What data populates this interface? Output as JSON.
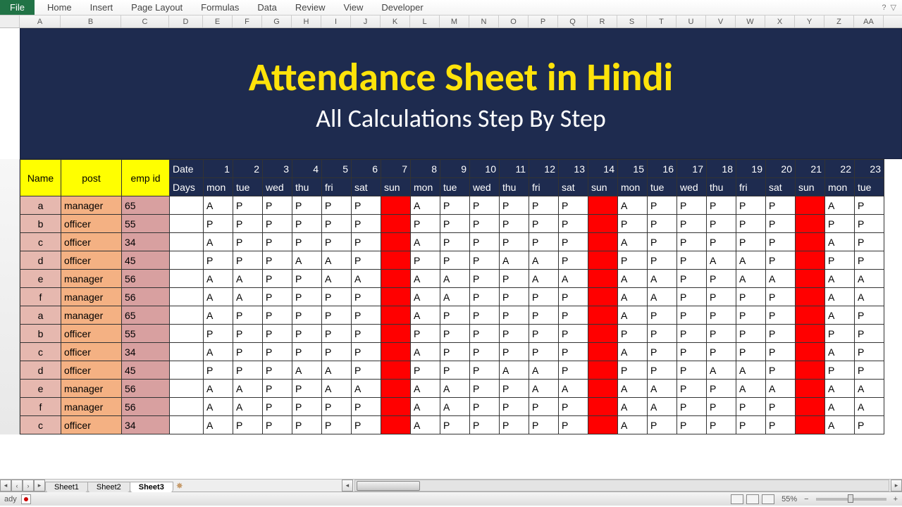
{
  "ribbon": {
    "file": "File",
    "tabs": [
      "Home",
      "Insert",
      "Page Layout",
      "Formulas",
      "Data",
      "Review",
      "View",
      "Developer"
    ]
  },
  "columns_excel": [
    "A",
    "B",
    "C",
    "D",
    "E",
    "F",
    "G",
    "H",
    "I",
    "J",
    "K",
    "L",
    "M",
    "N",
    "O",
    "P",
    "Q",
    "R",
    "S",
    "T",
    "U",
    "V",
    "W",
    "X",
    "Y",
    "Z",
    "AA"
  ],
  "banner": {
    "title": "Attendance Sheet in Hindi",
    "subtitle": "All Calculations Step By Step"
  },
  "headers": {
    "name": "Name",
    "post": "post",
    "empid": "emp id",
    "date_label": "Date",
    "days_label": "Days",
    "dates": [
      1,
      2,
      3,
      4,
      5,
      6,
      7,
      8,
      9,
      10,
      11,
      12,
      13,
      14,
      15,
      16,
      17,
      18,
      19,
      20,
      21,
      22,
      23
    ],
    "days": [
      "mon",
      "tue",
      "wed",
      "thu",
      "fri",
      "sat",
      "sun",
      "mon",
      "tue",
      "wed",
      "thu",
      "fri",
      "sat",
      "sun",
      "mon",
      "tue",
      "wed",
      "thu",
      "fri",
      "sat",
      "sun",
      "mon",
      "tue"
    ]
  },
  "rows": [
    {
      "name": "a",
      "post": "manager",
      "emp": "65",
      "att": [
        "A",
        "P",
        "P",
        "P",
        "P",
        "P",
        "",
        "A",
        "P",
        "P",
        "P",
        "P",
        "P",
        "",
        "A",
        "P",
        "P",
        "P",
        "P",
        "P",
        "",
        "A",
        "P"
      ]
    },
    {
      "name": "b",
      "post": "officer",
      "emp": "55",
      "att": [
        "P",
        "P",
        "P",
        "P",
        "P",
        "P",
        "",
        "P",
        "P",
        "P",
        "P",
        "P",
        "P",
        "",
        "P",
        "P",
        "P",
        "P",
        "P",
        "P",
        "",
        "P",
        "P"
      ]
    },
    {
      "name": "c",
      "post": "officer",
      "emp": "34",
      "att": [
        "A",
        "P",
        "P",
        "P",
        "P",
        "P",
        "",
        "A",
        "P",
        "P",
        "P",
        "P",
        "P",
        "",
        "A",
        "P",
        "P",
        "P",
        "P",
        "P",
        "",
        "A",
        "P"
      ]
    },
    {
      "name": "d",
      "post": "officer",
      "emp": "45",
      "att": [
        "P",
        "P",
        "P",
        "A",
        "A",
        "P",
        "",
        "P",
        "P",
        "P",
        "A",
        "A",
        "P",
        "",
        "P",
        "P",
        "P",
        "A",
        "A",
        "P",
        "",
        "P",
        "P"
      ]
    },
    {
      "name": "e",
      "post": "manager",
      "emp": "56",
      "att": [
        "A",
        "A",
        "P",
        "P",
        "A",
        "A",
        "",
        "A",
        "A",
        "P",
        "P",
        "A",
        "A",
        "",
        "A",
        "A",
        "P",
        "P",
        "A",
        "A",
        "",
        "A",
        "A"
      ]
    },
    {
      "name": "f",
      "post": "manager",
      "emp": "56",
      "att": [
        "A",
        "A",
        "P",
        "P",
        "P",
        "P",
        "",
        "A",
        "A",
        "P",
        "P",
        "P",
        "P",
        "",
        "A",
        "A",
        "P",
        "P",
        "P",
        "P",
        "",
        "A",
        "A"
      ]
    },
    {
      "name": "a",
      "post": "manager",
      "emp": "65",
      "att": [
        "A",
        "P",
        "P",
        "P",
        "P",
        "P",
        "",
        "A",
        "P",
        "P",
        "P",
        "P",
        "P",
        "",
        "A",
        "P",
        "P",
        "P",
        "P",
        "P",
        "",
        "A",
        "P"
      ]
    },
    {
      "name": "b",
      "post": "officer",
      "emp": "55",
      "att": [
        "P",
        "P",
        "P",
        "P",
        "P",
        "P",
        "",
        "P",
        "P",
        "P",
        "P",
        "P",
        "P",
        "",
        "P",
        "P",
        "P",
        "P",
        "P",
        "P",
        "",
        "P",
        "P"
      ]
    },
    {
      "name": "c",
      "post": "officer",
      "emp": "34",
      "att": [
        "A",
        "P",
        "P",
        "P",
        "P",
        "P",
        "",
        "A",
        "P",
        "P",
        "P",
        "P",
        "P",
        "",
        "A",
        "P",
        "P",
        "P",
        "P",
        "P",
        "",
        "A",
        "P"
      ]
    },
    {
      "name": "d",
      "post": "officer",
      "emp": "45",
      "att": [
        "P",
        "P",
        "P",
        "A",
        "A",
        "P",
        "",
        "P",
        "P",
        "P",
        "A",
        "A",
        "P",
        "",
        "P",
        "P",
        "P",
        "A",
        "A",
        "P",
        "",
        "P",
        "P"
      ]
    },
    {
      "name": "e",
      "post": "manager",
      "emp": "56",
      "att": [
        "A",
        "A",
        "P",
        "P",
        "A",
        "A",
        "",
        "A",
        "A",
        "P",
        "P",
        "A",
        "A",
        "",
        "A",
        "A",
        "P",
        "P",
        "A",
        "A",
        "",
        "A",
        "A"
      ]
    },
    {
      "name": "f",
      "post": "manager",
      "emp": "56",
      "att": [
        "A",
        "A",
        "P",
        "P",
        "P",
        "P",
        "",
        "A",
        "A",
        "P",
        "P",
        "P",
        "P",
        "",
        "A",
        "A",
        "P",
        "P",
        "P",
        "P",
        "",
        "A",
        "A"
      ]
    },
    {
      "name": "c",
      "post": "officer",
      "emp": "34",
      "att": [
        "A",
        "P",
        "P",
        "P",
        "P",
        "P",
        "",
        "A",
        "P",
        "P",
        "P",
        "P",
        "P",
        "",
        "A",
        "P",
        "P",
        "P",
        "P",
        "P",
        "",
        "A",
        "P"
      ]
    }
  ],
  "col_widths": {
    "name": 58,
    "post": 86,
    "empid": 68,
    "date_label": 48,
    "day": 42
  },
  "sun_indices": [
    6,
    13,
    20
  ],
  "sheets": {
    "tabs": [
      "Sheet1",
      "Sheet2",
      "Sheet3"
    ],
    "active": 2
  },
  "status": {
    "ready": "ady",
    "zoom": "55%",
    "minus": "−",
    "plus": "+"
  }
}
